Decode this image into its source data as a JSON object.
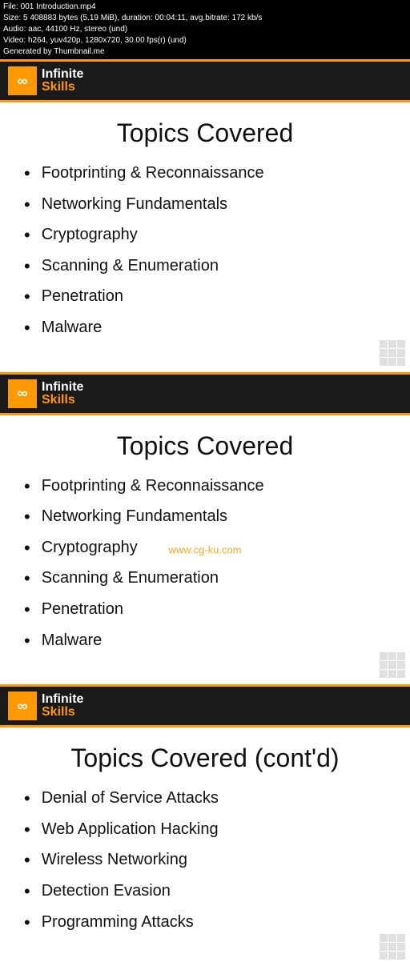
{
  "topBar": {
    "line1": "File: 001 Introduction.mp4",
    "line2": "Size: 5 408883 bytes (5.19 MiB), duration: 00:04:11, avg.bitrate: 172 kb/s",
    "line3": "Audio: aac, 44100 Hz, stereo (und)",
    "line4": "Video: h264, yuv420p, 1280x720, 30.00 fps(r) (und)",
    "line5": "Generated by Thumbnail.me"
  },
  "logo": {
    "infinite": "Infinite",
    "skills": "Skills",
    "icon": "∞"
  },
  "slide1": {
    "title": "Topics Covered",
    "items": [
      "Footprinting & Reconnaissance",
      "Networking Fundamentals",
      "Cryptography",
      "Scanning & Enumeration",
      "Penetration",
      "Malware"
    ]
  },
  "slide2": {
    "title": "Topics Covered",
    "items": [
      "Footprinting & Reconnaissance",
      "Networking Fundamentals",
      "Cryptography",
      "Scanning & Enumeration",
      "Penetration",
      "Malware"
    ],
    "watermark": "www.cg-ku.com"
  },
  "slide3": {
    "title": "Topics Covered (cont'd)",
    "items": [
      "Denial of Service Attacks",
      "Web Application Hacking",
      "Wireless Networking",
      "Detection Evasion",
      "Programming Attacks"
    ]
  }
}
